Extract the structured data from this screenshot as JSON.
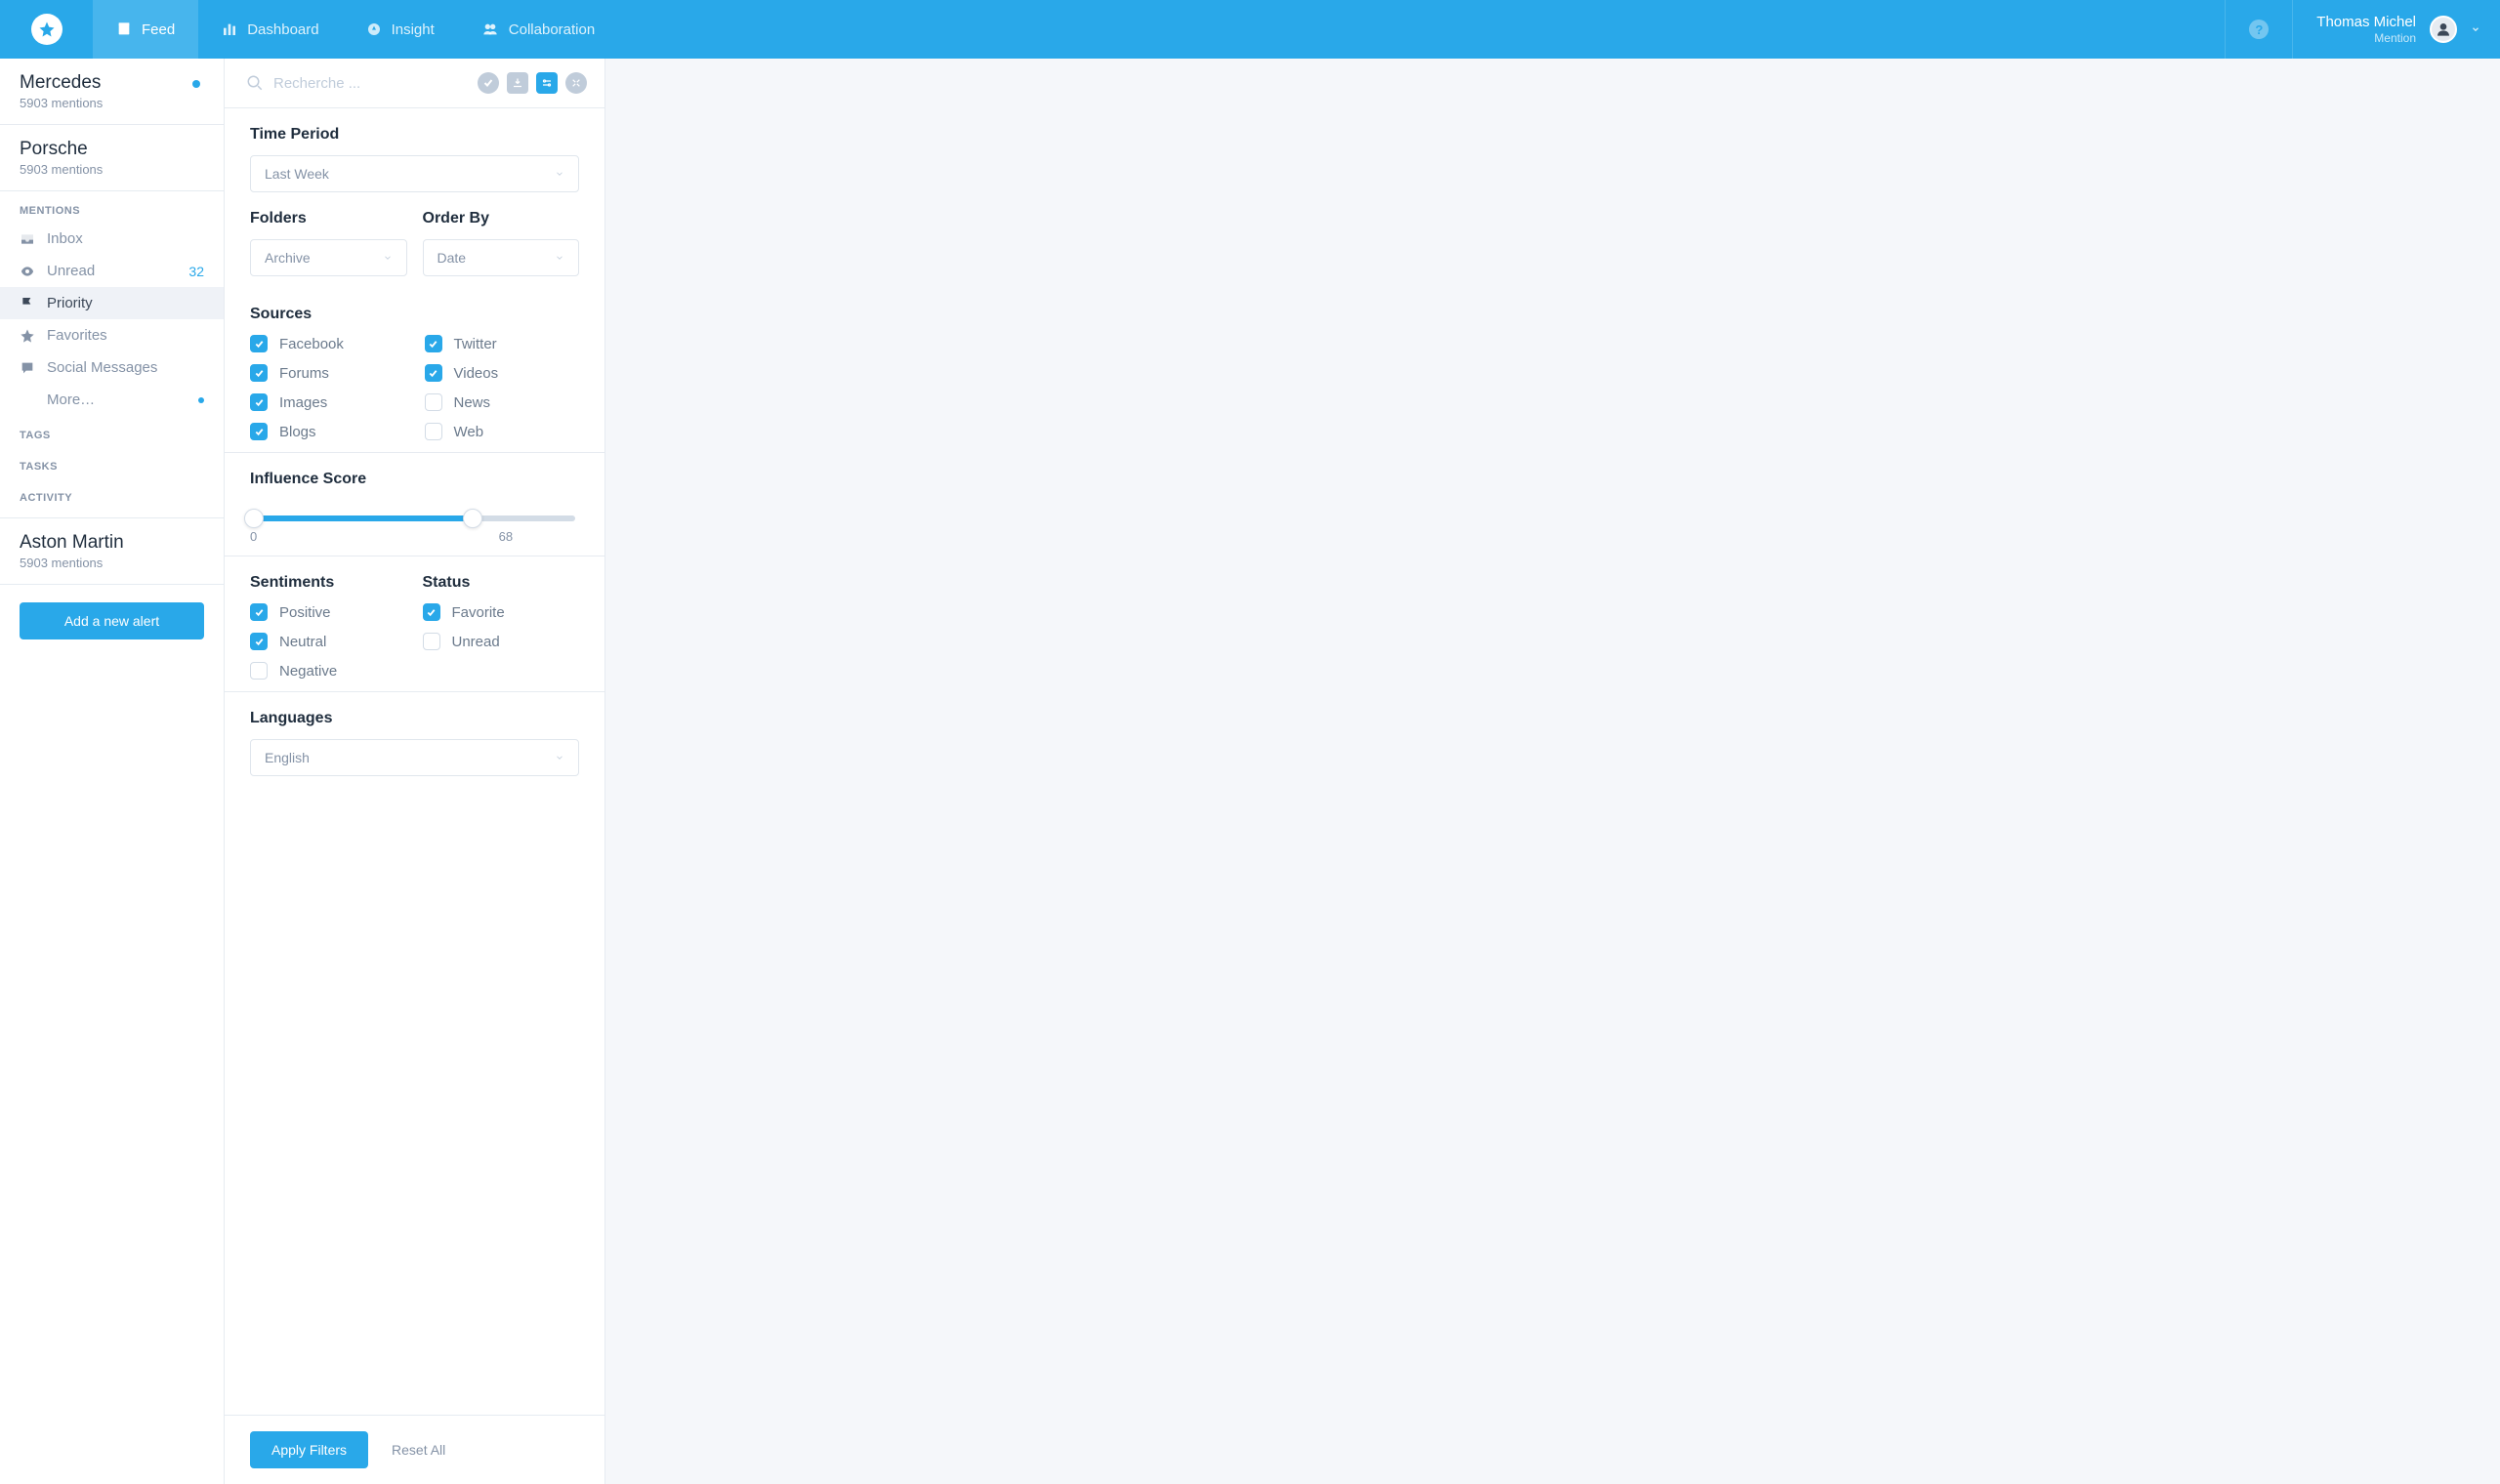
{
  "nav": {
    "items": [
      {
        "label": "Feed",
        "active": true
      },
      {
        "label": "Dashboard",
        "active": false
      },
      {
        "label": "Insight",
        "active": false
      },
      {
        "label": "Collaboration",
        "active": false
      }
    ],
    "user_name": "Thomas Michel",
    "user_sub": "Mention"
  },
  "sidebar": {
    "alerts": [
      {
        "title": "Mercedes",
        "sub": "5903 mentions",
        "active": true
      },
      {
        "title": "Porsche",
        "sub": "5903 mentions",
        "active": false
      }
    ],
    "sections": {
      "mentions": {
        "label": "MENTIONS",
        "items": [
          {
            "label": "Inbox",
            "active": false
          },
          {
            "label": "Unread",
            "active": false,
            "count": "32"
          },
          {
            "label": "Priority",
            "active": true
          },
          {
            "label": "Favorites",
            "active": false
          },
          {
            "label": "Social Messages",
            "active": false
          },
          {
            "label": "More…",
            "active": false,
            "dot": true
          }
        ]
      },
      "tags": {
        "label": "TAGS"
      },
      "tasks": {
        "label": "TASKS"
      },
      "activity": {
        "label": "ACTIVITY"
      }
    },
    "bottom_alert": {
      "title": "Aston Martin",
      "sub": "5903 mentions"
    },
    "add_alert_label": "Add a new alert"
  },
  "filters": {
    "search_placeholder": "Recherche ...",
    "time_period": {
      "title": "Time Period",
      "value": "Last Week"
    },
    "folders": {
      "title": "Folders",
      "value": "Archive"
    },
    "order_by": {
      "title": "Order By",
      "value": "Date"
    },
    "sources": {
      "title": "Sources",
      "items": [
        {
          "label": "Facebook",
          "checked": true
        },
        {
          "label": "Twitter",
          "checked": true
        },
        {
          "label": "Forums",
          "checked": true
        },
        {
          "label": "Videos",
          "checked": true
        },
        {
          "label": "Images",
          "checked": true
        },
        {
          "label": "News",
          "checked": false
        },
        {
          "label": "Blogs",
          "checked": true
        },
        {
          "label": "Web",
          "checked": false
        }
      ]
    },
    "influence": {
      "title": "Influence Score",
      "min": "0",
      "max": "68",
      "max_pct": 68
    },
    "sentiments": {
      "title": "Sentiments",
      "items": [
        {
          "label": "Positive",
          "checked": true
        },
        {
          "label": "Neutral",
          "checked": true
        },
        {
          "label": "Negative",
          "checked": false
        }
      ]
    },
    "status": {
      "title": "Status",
      "items": [
        {
          "label": "Favorite",
          "checked": true
        },
        {
          "label": "Unread",
          "checked": false
        }
      ]
    },
    "languages": {
      "title": "Languages",
      "value": "English"
    },
    "apply_label": "Apply Filters",
    "reset_label": "Reset All"
  }
}
